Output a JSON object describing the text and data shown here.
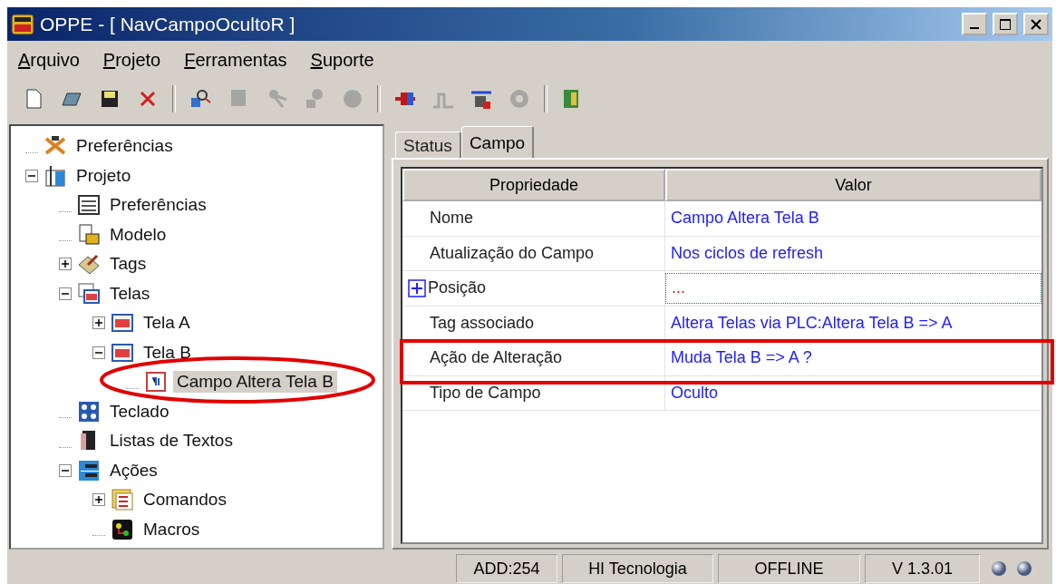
{
  "window": {
    "title": "OPPE - [ NavCampoOcultoR ]"
  },
  "menu": [
    "Arquivo",
    "Projeto",
    "Ferramentas",
    "Suporte"
  ],
  "toolbar": [
    {
      "kind": "new",
      "disabled": false
    },
    {
      "kind": "open",
      "disabled": false
    },
    {
      "kind": "save",
      "disabled": false
    },
    {
      "kind": "delete",
      "disabled": false
    },
    {
      "kind": "separator"
    },
    {
      "kind": "find",
      "disabled": false
    },
    {
      "kind": "device",
      "disabled": true
    },
    {
      "kind": "probe",
      "disabled": true
    },
    {
      "kind": "network",
      "disabled": true
    },
    {
      "kind": "disc",
      "disabled": true
    },
    {
      "kind": "separator"
    },
    {
      "kind": "connect",
      "disabled": false
    },
    {
      "kind": "signal",
      "disabled": true
    },
    {
      "kind": "monitor",
      "disabled": false
    },
    {
      "kind": "gear",
      "disabled": true
    },
    {
      "kind": "separator"
    },
    {
      "kind": "exit",
      "disabled": false
    }
  ],
  "tree": [
    {
      "label": "Preferências",
      "kind": "tools",
      "selected": false
    },
    {
      "label": "Projeto",
      "kind": "project",
      "expanded": true,
      "selected": false,
      "children": [
        {
          "label": "Preferências",
          "kind": "checklist",
          "selected": false
        },
        {
          "label": "Modelo",
          "kind": "model",
          "selected": false
        },
        {
          "label": "Tags",
          "kind": "tags",
          "expanded": false,
          "selected": false
        },
        {
          "label": "Telas",
          "kind": "screens",
          "expanded": true,
          "selected": false,
          "children": [
            {
              "label": "Tela A",
              "kind": "screen",
              "expanded": false,
              "selected": false
            },
            {
              "label": "Tela B",
              "kind": "screen",
              "expanded": true,
              "selected": false,
              "children": [
                {
                  "label": "Campo Altera Tela B",
                  "kind": "field",
                  "selected": true,
                  "circled": true
                }
              ]
            }
          ]
        },
        {
          "label": "Teclado",
          "kind": "keyboard",
          "selected": false
        },
        {
          "label": "Listas de Textos",
          "kind": "book",
          "selected": false
        },
        {
          "label": "Ações",
          "kind": "actions",
          "expanded": true,
          "selected": false,
          "children": [
            {
              "label": "Comandos",
              "kind": "commands",
              "expanded": false,
              "selected": false
            },
            {
              "label": "Macros",
              "kind": "macro",
              "selected": false
            }
          ]
        }
      ]
    }
  ],
  "tabs": [
    {
      "label": "Status",
      "selected": false
    },
    {
      "label": "Campo",
      "selected": true
    }
  ],
  "table": {
    "columns": [
      "Propriedade",
      "Valor"
    ],
    "rows": [
      {
        "property": "Nome",
        "value": "Campo Altera Tela B",
        "highlighted": false
      },
      {
        "property": "Atualização do Campo",
        "value": "Nos ciclos de refresh",
        "highlighted": false
      },
      {
        "property": "Posição",
        "value": "...",
        "expanded": false,
        "focused": true,
        "highlighted": false
      },
      {
        "property": "Tag associado",
        "value": "Altera Telas via PLC:Altera Tela B => A",
        "highlighted": false
      },
      {
        "property": "Ação de Alteração",
        "value": "Muda Tela B => A ?",
        "highlighted": true
      },
      {
        "property": "Tipo de Campo",
        "value": "Oculto",
        "highlighted": false
      }
    ]
  },
  "status_bar": [
    "ADD:254",
    "HI Tecnologia",
    "OFFLINE",
    "V 1.3.01"
  ]
}
